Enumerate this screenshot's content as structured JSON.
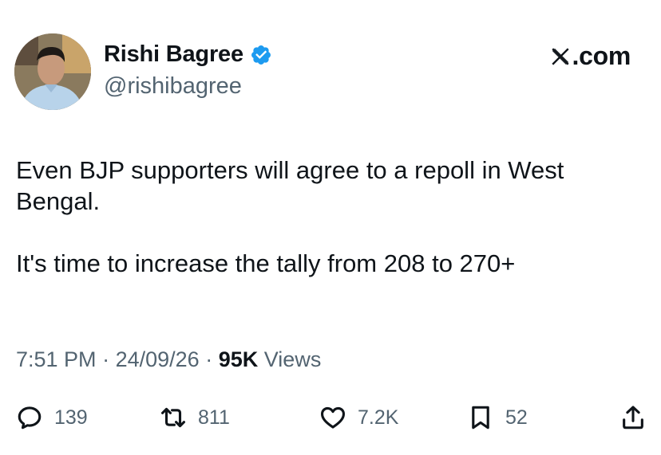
{
  "author": {
    "name": "Rishi Bagree",
    "handle": "@rishibagree",
    "verified": true
  },
  "site": {
    "logo_text": ".com"
  },
  "tweet": {
    "paragraphs": [
      "Even BJP supporters will agree to a repoll in West Bengal.",
      "It's time to increase the tally from 208 to 270+"
    ],
    "time": "7:51 PM",
    "date": "24/09/26",
    "views_count": "95K",
    "views_label": "Views",
    "separator": "·"
  },
  "actions": {
    "replies": "139",
    "reposts": "811",
    "likes": "7.2K",
    "bookmarks": "52"
  },
  "colors": {
    "text": "#0f1419",
    "secondary": "#536471",
    "verified_blue": "#1d9bf0"
  },
  "icons": [
    "verified-badge-icon",
    "x-logo-icon",
    "reply-icon",
    "repost-icon",
    "like-icon",
    "bookmark-icon",
    "share-icon"
  ]
}
